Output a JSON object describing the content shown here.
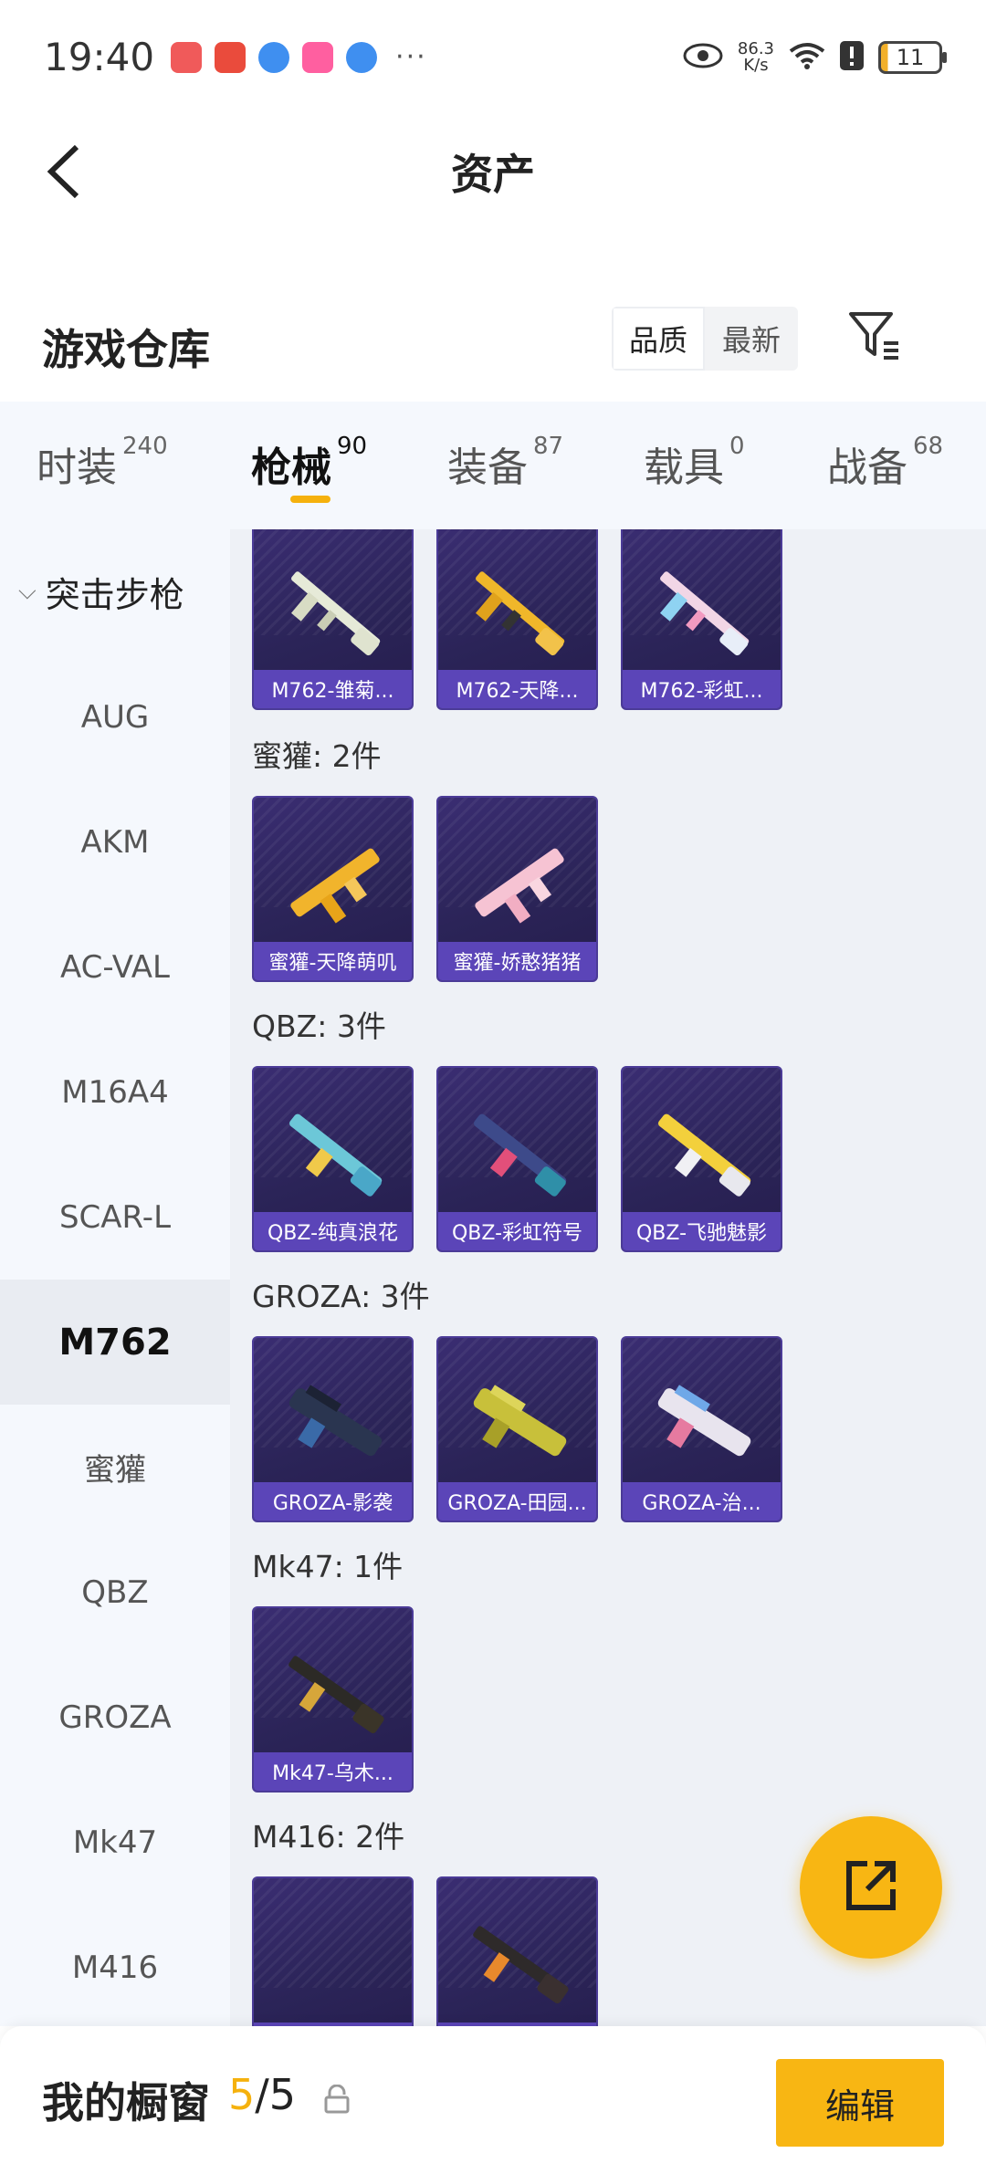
{
  "status_bar": {
    "time": "19:40",
    "net_speed_value": "86.3",
    "net_speed_unit": "K/s",
    "battery": "11",
    "more": "···"
  },
  "nav": {
    "title": "资产",
    "back_icon": "chevron-left-icon"
  },
  "warehouse": {
    "title": "游戏仓库",
    "sort_options": [
      "品质",
      "最新"
    ],
    "sort_selected": "品质",
    "filter_icon": "filter-icon"
  },
  "tabs": [
    {
      "label": "时装",
      "count": "240"
    },
    {
      "label": "枪械",
      "count": "90"
    },
    {
      "label": "装备",
      "count": "87"
    },
    {
      "label": "载具",
      "count": "0"
    },
    {
      "label": "战备",
      "count": "68"
    }
  ],
  "active_tab": "枪械",
  "sidebar": {
    "group": "突击步枪",
    "items": [
      "AUG",
      "AKM",
      "AC-VAL",
      "M16A4",
      "SCAR-L",
      "M762",
      "蜜獾",
      "QBZ",
      "GROZA",
      "Mk47",
      "M416"
    ],
    "active": "M762"
  },
  "groups": [
    {
      "title": "",
      "items": [
        "M762-雏菊...",
        "M762-天降...",
        "M762-彩虹..."
      ]
    },
    {
      "title": "蜜獾: 2件",
      "items": [
        "蜜獾-天降萌叽",
        "蜜獾-娇憨猪猪"
      ]
    },
    {
      "title": "QBZ: 3件",
      "items": [
        "QBZ-纯真浪花",
        "QBZ-彩虹符号",
        "QBZ-飞驰魅影"
      ]
    },
    {
      "title": "GROZA: 3件",
      "items": [
        "GROZA-影袭",
        "GROZA-田园...",
        "GROZA-治..."
      ]
    },
    {
      "title": "Mk47: 1件",
      "items": [
        "Mk47-乌木..."
      ]
    },
    {
      "title": "M416: 2件",
      "items": [
        "",
        ""
      ]
    }
  ],
  "bottom": {
    "title": "我的橱窗",
    "current": "5",
    "total": "/5",
    "edit_label": "编辑"
  },
  "colors": {
    "accent": "#f8b613",
    "card_bg": "#2b2458",
    "card_label": "#5b45b8"
  }
}
